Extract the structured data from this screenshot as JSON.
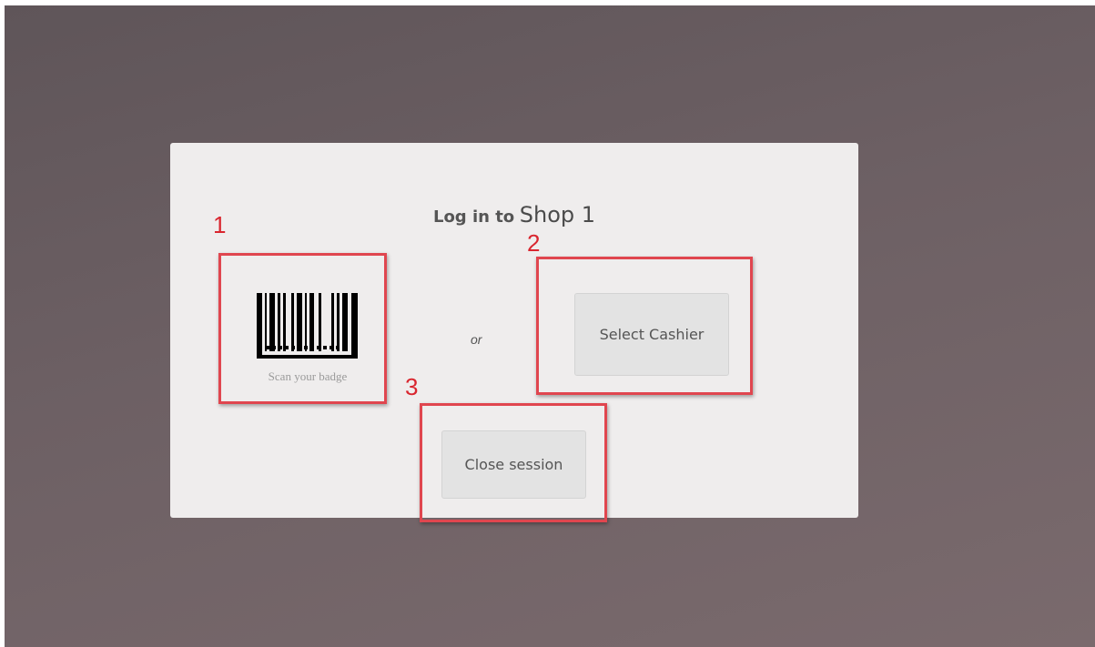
{
  "login": {
    "title_prefix": "Log in to",
    "shop_name": "Shop 1",
    "scan_badge_label": "Scan your badge",
    "or_label": "or",
    "select_cashier_label": "Select Cashier",
    "close_session_label": "Close session"
  },
  "annotations": {
    "marker_1": "1",
    "marker_2": "2",
    "marker_3": "3",
    "highlight_color": "#e0464f",
    "marker_color": "#d9262f"
  },
  "icons": {
    "badge": "barcode-icon"
  }
}
